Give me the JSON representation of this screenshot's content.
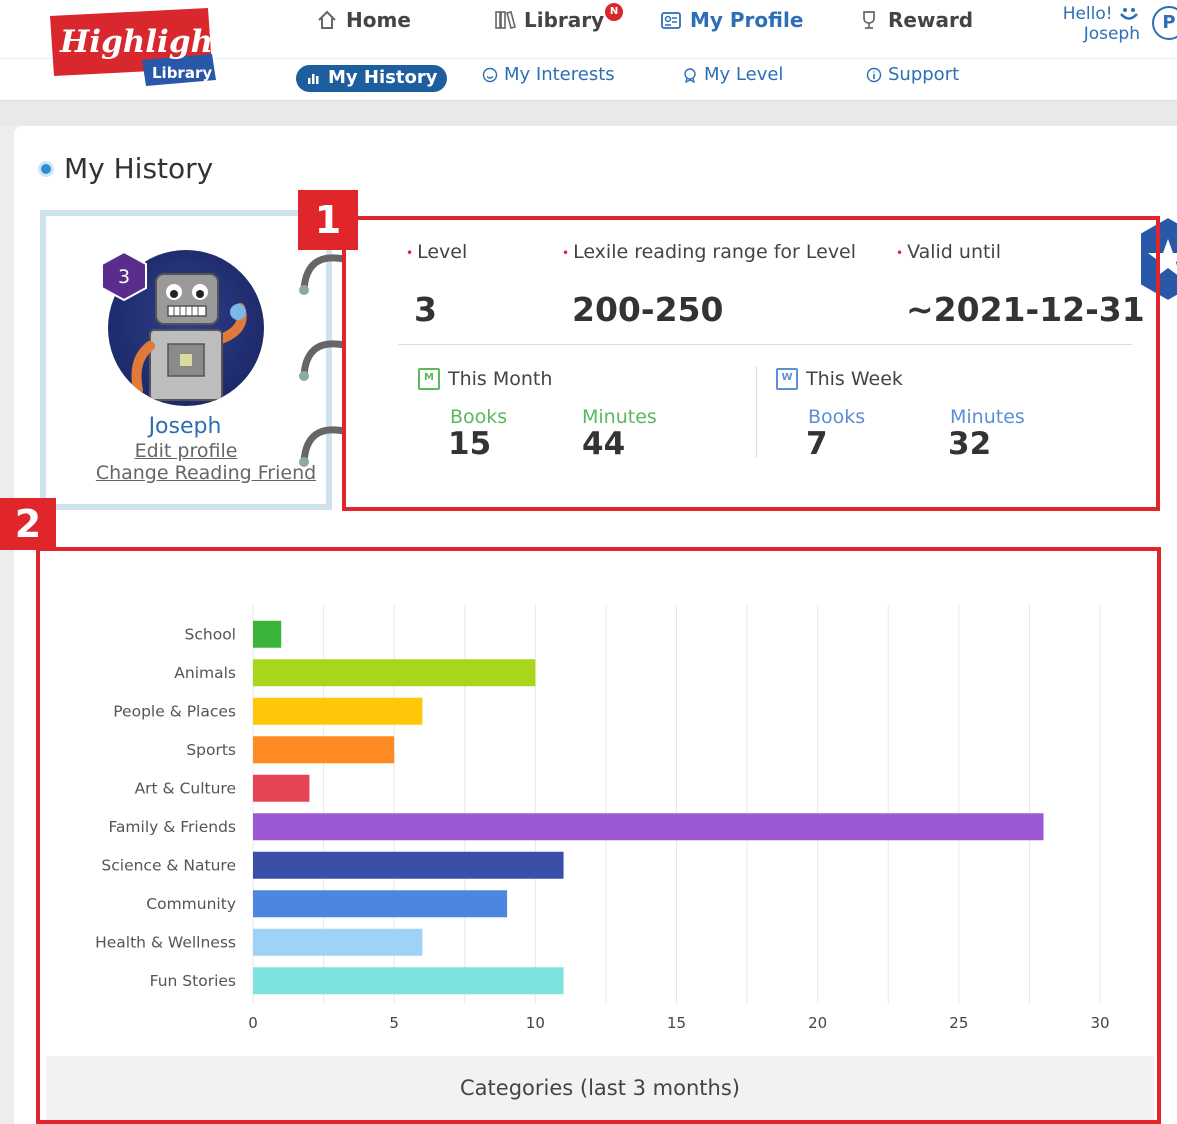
{
  "brand": {
    "logo_main": "Highlights",
    "logo_sub": "Library"
  },
  "nav": {
    "home": "Home",
    "library": "Library",
    "library_badge": "N",
    "my_profile": "My Profile",
    "reward": "Reward"
  },
  "user": {
    "hello": "Hello!",
    "name": "Joseph",
    "chip": "P"
  },
  "subnav": {
    "my_history": "My History",
    "my_interests": "My Interests",
    "my_level": "My Level",
    "support": "Support"
  },
  "page": {
    "title": "My History"
  },
  "profile": {
    "level_badge": "3",
    "name": "Joseph",
    "edit_link": "Edit profile",
    "change_friend_link": "Change Reading Friend"
  },
  "stats": {
    "level_label": "Level",
    "level_value": "3",
    "lexile_label": "Lexile reading range for Level",
    "lexile_value": "200-250",
    "valid_label": "Valid until",
    "valid_value": "~2021-12-31",
    "this_month": {
      "title": "This Month",
      "icon_letter": "M",
      "books_label": "Books",
      "books_value": "15",
      "minutes_label": "Minutes",
      "minutes_value": "44"
    },
    "this_week": {
      "title": "This Week",
      "icon_letter": "W",
      "books_label": "Books",
      "books_value": "7",
      "minutes_label": "Minutes",
      "minutes_value": "32"
    }
  },
  "annotations": {
    "box1": "1",
    "box2": "2"
  },
  "colors": {
    "accent_blue": "#2d6fb6",
    "annotation_red": "#e0262b",
    "month_green": "#5cb85c",
    "week_blue": "#5b8fd8"
  },
  "chart_data": {
    "type": "bar",
    "orientation": "horizontal",
    "title": "Categories (last 3 months)",
    "categories": [
      "School",
      "Animals",
      "People & Places",
      "Sports",
      "Art & Culture",
      "Family & Friends",
      "Science & Nature",
      "Community",
      "Health & Wellness",
      "Fun Stories"
    ],
    "values": [
      1,
      10,
      6,
      5,
      2,
      28,
      11,
      9,
      6,
      11
    ],
    "colors": [
      "#3cb43c",
      "#a8d61a",
      "#ffc60a",
      "#fd8a22",
      "#e64556",
      "#9b59d6",
      "#3a4fa8",
      "#4b86e0",
      "#9fd3f5",
      "#7ee3dc"
    ],
    "xlim": [
      0,
      30
    ],
    "xticks": [
      0,
      5,
      10,
      15,
      20,
      25,
      30
    ],
    "grid": true,
    "legend": "none"
  }
}
